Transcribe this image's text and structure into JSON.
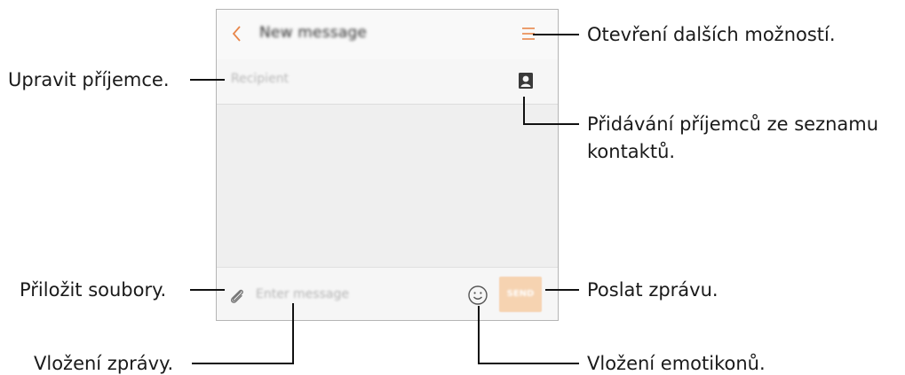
{
  "screen": {
    "title": "New message",
    "recipient_placeholder": "Recipient",
    "message_placeholder": "Enter message",
    "send_label": "SEND"
  },
  "icons": {
    "back": "chevron-left-icon",
    "menu": "menu-icon",
    "contacts": "contact-icon",
    "attach": "paperclip-icon",
    "emoji": "emoji-icon"
  },
  "callouts": {
    "more_options": "Otevření dalších možností.",
    "edit_recipients": "Upravit příjemce.",
    "add_from_contacts_line1": "Přidávání příjemců ze seznamu",
    "add_from_contacts_line2": "kontaktů.",
    "attach_files": "Přiložit soubory.",
    "send_message": "Poslat zprávu.",
    "enter_message": "Vložení zprávy.",
    "insert_emoticons": "Vložení emotikonů."
  },
  "colors": {
    "accent": "#e8864a",
    "send_button": "#f6d3b1"
  }
}
